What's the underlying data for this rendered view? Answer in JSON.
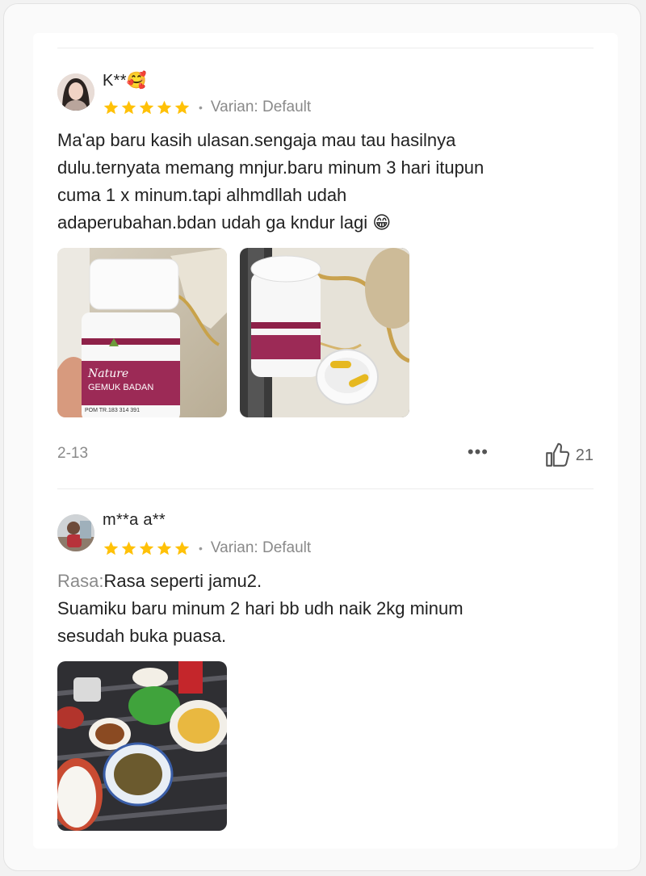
{
  "reviews": [
    {
      "username": "K**🥰",
      "rating": 5,
      "variant": "Varian: Default",
      "text_lines": [
        "Ma'ap baru kasih ulasan.sengaja mau tau hasilnya",
        "dulu.ternyata memang mnjur.baru minum 3 hari itupun",
        "cuma 1 x minum.tapi alhmdllah udah",
        "adaperubahan.bdan udah ga kndur lagi 😁"
      ],
      "photo1": {
        "brand": "Nature",
        "product": "GEMUK BADAN",
        "pom": "POM TR.183 314 391"
      },
      "date": "2-13",
      "likes": "21"
    },
    {
      "username": "m**a a**",
      "rating": 5,
      "variant": "Varian: Default",
      "rasa_label": "Rasa:",
      "rasa_value": "Rasa seperti jamu2.",
      "text_lines": [
        "Suamiku baru minum 2 hari bb udh naik 2kg minum",
        "sesudah buka puasa."
      ]
    }
  ],
  "icons": {
    "star": "star-icon",
    "more": "more-icon",
    "like": "thumbs-up-icon"
  },
  "colors": {
    "star": "#FFC107",
    "muted_text": "#8a8a8a"
  },
  "more_glyph": "•••"
}
